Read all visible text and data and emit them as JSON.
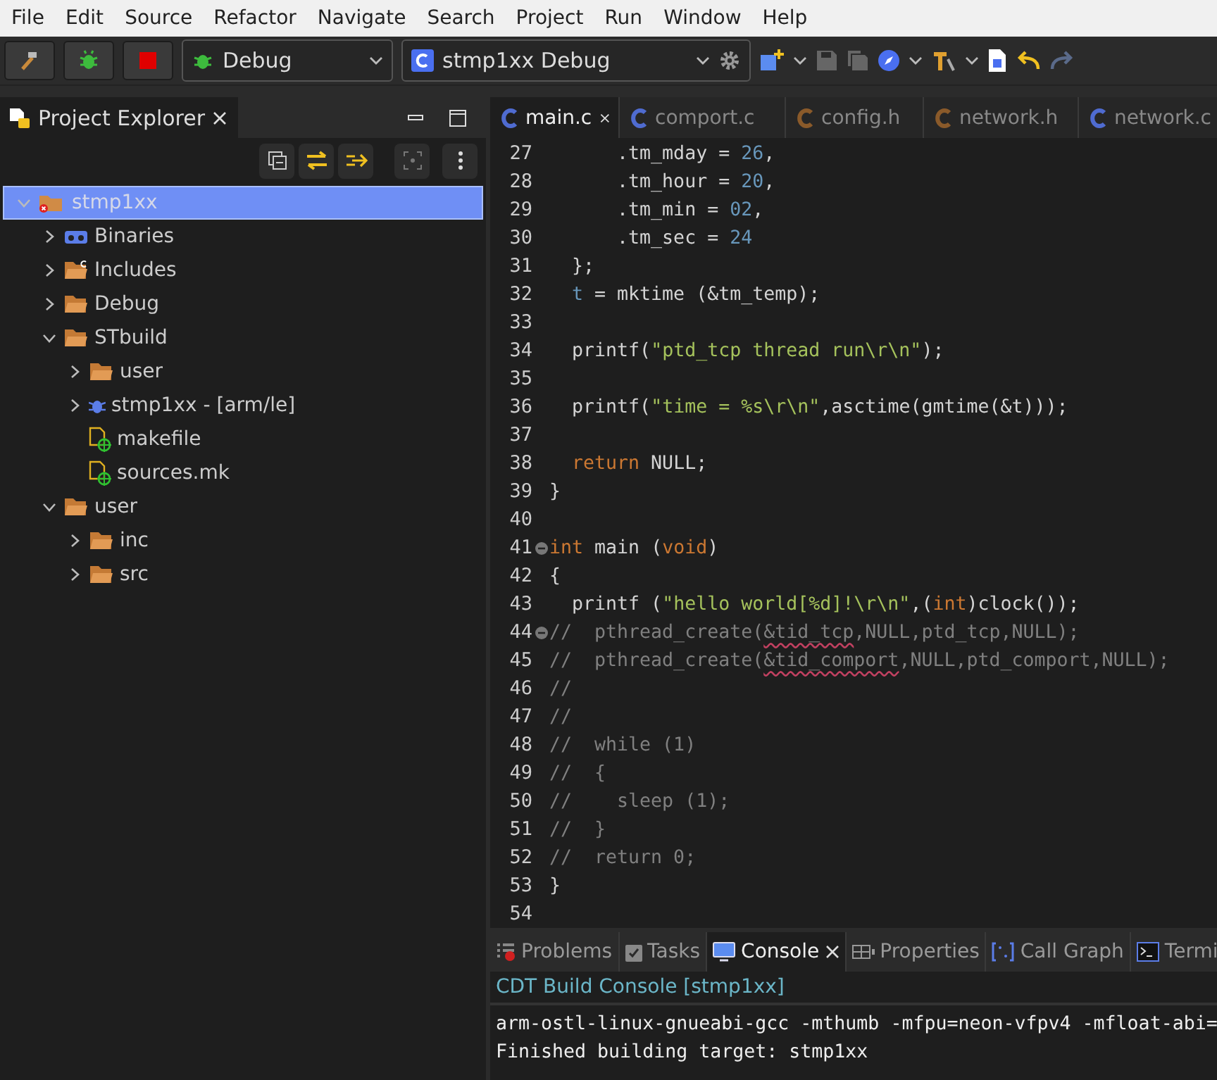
{
  "menu": [
    "File",
    "Edit",
    "Source",
    "Refactor",
    "Navigate",
    "Search",
    "Project",
    "Run",
    "Window",
    "Help"
  ],
  "toolbar": {
    "launch_mode": "Debug",
    "launch_config": "stmp1xx Debug"
  },
  "explorer": {
    "title": "Project Explorer",
    "tree": [
      {
        "label": "stmp1xx",
        "kind": "project",
        "expanded": true,
        "selected": true,
        "children": [
          {
            "label": "Binaries",
            "kind": "binaries",
            "expanded": false,
            "selected": false
          },
          {
            "label": "Includes",
            "kind": "includes",
            "expanded": false,
            "selected": false
          },
          {
            "label": "Debug",
            "kind": "folder",
            "expanded": false,
            "selected": false
          },
          {
            "label": "STbuild",
            "kind": "folder",
            "expanded": true,
            "selected": false,
            "children": [
              {
                "label": "user",
                "kind": "folder",
                "expanded": false,
                "selected": false
              },
              {
                "label": "stmp1xx - [arm/le]",
                "kind": "binary",
                "expanded": false,
                "selected": false
              },
              {
                "label": "makefile",
                "kind": "file",
                "selected": false
              },
              {
                "label": "sources.mk",
                "kind": "file",
                "selected": false
              }
            ]
          },
          {
            "label": "user",
            "kind": "folder",
            "expanded": true,
            "selected": false,
            "children": [
              {
                "label": "inc",
                "kind": "folder",
                "expanded": false,
                "selected": false
              },
              {
                "label": "src",
                "kind": "folder",
                "expanded": false,
                "selected": false
              }
            ]
          }
        ]
      }
    ]
  },
  "editor": {
    "tabs": [
      {
        "label": "main.c",
        "kind": "source",
        "selected": true
      },
      {
        "label": "comport.c",
        "kind": "source",
        "selected": false
      },
      {
        "label": "config.h",
        "kind": "header",
        "selected": false
      },
      {
        "label": "network.h",
        "kind": "header",
        "selected": false
      },
      {
        "label": "network.c",
        "kind": "source",
        "selected": false
      }
    ],
    "lines": [
      {
        "number": "27",
        "tokens": [
          {
            "kind": "plain",
            "text": "      .tm_mday = "
          },
          {
            "kind": "number",
            "text": "26"
          },
          {
            "kind": "plain",
            "text": ","
          }
        ]
      },
      {
        "number": "28",
        "tokens": [
          {
            "kind": "plain",
            "text": "      .tm_hour = "
          },
          {
            "kind": "number",
            "text": "20"
          },
          {
            "kind": "plain",
            "text": ","
          }
        ]
      },
      {
        "number": "29",
        "tokens": [
          {
            "kind": "plain",
            "text": "      .tm_min = "
          },
          {
            "kind": "number",
            "text": "02"
          },
          {
            "kind": "plain",
            "text": ","
          }
        ]
      },
      {
        "number": "30",
        "tokens": [
          {
            "kind": "plain",
            "text": "      .tm_sec = "
          },
          {
            "kind": "number",
            "text": "24"
          }
        ]
      },
      {
        "number": "31",
        "tokens": [
          {
            "kind": "plain",
            "text": "  };"
          }
        ]
      },
      {
        "number": "32",
        "nested": true,
        "tokens": [
          {
            "kind": "variable",
            "text": "t"
          },
          {
            "kind": "plain",
            "text": " = mktime (&tm_temp);"
          }
        ]
      },
      {
        "number": "33"
      },
      {
        "number": "34",
        "tokens": [
          {
            "kind": "plain",
            "text": "  printf("
          },
          {
            "kind": "string",
            "text": "\"ptd_tcp thread run\\r\\n\""
          },
          {
            "kind": "plain",
            "text": ");"
          }
        ]
      },
      {
        "number": "35"
      },
      {
        "number": "36",
        "tokens": [
          {
            "kind": "plain",
            "text": "  printf("
          },
          {
            "kind": "string",
            "text": "\"time = %s\\r\\n\""
          },
          {
            "kind": "plain",
            "text": ",asctime(gmtime(&t)));"
          }
        ]
      },
      {
        "number": "37"
      },
      {
        "number": "38",
        "nested": true,
        "tokens": [
          {
            "kind": "keyword",
            "text": "return"
          },
          {
            "kind": "plain",
            "text": " NULL;"
          }
        ]
      },
      {
        "number": "39",
        "tokens": [
          {
            "kind": "plain",
            "text": "}"
          }
        ]
      },
      {
        "number": "40"
      },
      {
        "number": "41",
        "fold": true,
        "tokens": [
          {
            "kind": "keyword",
            "text": "int"
          },
          {
            "kind": "plain",
            "text": " main ("
          },
          {
            "kind": "keyword",
            "text": "void"
          },
          {
            "kind": "plain",
            "text": ")"
          }
        ]
      },
      {
        "number": "42",
        "tokens": [
          {
            "kind": "plain",
            "text": "{"
          }
        ]
      },
      {
        "number": "43",
        "tokens": [
          {
            "kind": "plain",
            "text": "  printf ("
          },
          {
            "kind": "string",
            "text": "\"hello world[%d]!\\r\\n\""
          },
          {
            "kind": "plain",
            "text": ",("
          },
          {
            "kind": "keyword",
            "text": "int"
          },
          {
            "kind": "plain",
            "text": ")clock());"
          }
        ]
      },
      {
        "number": "44",
        "fold": true,
        "tokens": [
          {
            "kind": "comment",
            "text": "//  pthread_create("
          },
          {
            "kind": "misspelled",
            "text": "&tid_tcp"
          },
          {
            "kind": "comment",
            "text": ",NULL,ptd_tcp,NULL);"
          }
        ]
      },
      {
        "number": "45",
        "tokens": [
          {
            "kind": "comment",
            "text": "//  pthread_create("
          },
          {
            "kind": "misspelled",
            "text": "&tid_comport"
          },
          {
            "kind": "comment",
            "text": ",NULL,ptd_comport,NULL);"
          }
        ]
      },
      {
        "number": "46",
        "tokens": [
          {
            "kind": "comment",
            "text": "//"
          }
        ]
      },
      {
        "number": "47",
        "tokens": [
          {
            "kind": "comment",
            "text": "//"
          }
        ]
      },
      {
        "number": "48",
        "tokens": [
          {
            "kind": "comment",
            "text": "//  while (1)"
          }
        ]
      },
      {
        "number": "49",
        "tokens": [
          {
            "kind": "comment",
            "text": "//  {"
          }
        ]
      },
      {
        "number": "50",
        "tokens": [
          {
            "kind": "comment",
            "text": "//    sleep (1);"
          }
        ]
      },
      {
        "number": "51",
        "tokens": [
          {
            "kind": "comment",
            "text": "//  }"
          }
        ]
      },
      {
        "number": "52",
        "tokens": [
          {
            "kind": "comment",
            "text": "//  return 0;"
          }
        ]
      },
      {
        "number": "53",
        "tokens": [
          {
            "kind": "plain",
            "text": "}"
          }
        ]
      },
      {
        "number": "54"
      }
    ]
  },
  "bottom": {
    "tabs": [
      {
        "label": "Problems",
        "kind": "problems",
        "selected": false
      },
      {
        "label": "Tasks",
        "kind": "tasks",
        "selected": false
      },
      {
        "label": "Console",
        "kind": "console",
        "selected": true
      },
      {
        "label": "Properties",
        "kind": "properties",
        "selected": false
      },
      {
        "label": "Call Graph",
        "kind": "callgraph",
        "selected": false
      },
      {
        "label": "Termi",
        "kind": "terminal",
        "selected": false
      }
    ],
    "console_title": "CDT Build Console [stmp1xx]",
    "output": [
      "arm-ostl-linux-gnueabi-gcc -mthumb -mfpu=neon-vfpv4 -mfloat-abi=",
      "Finished building target: stmp1xx"
    ]
  }
}
